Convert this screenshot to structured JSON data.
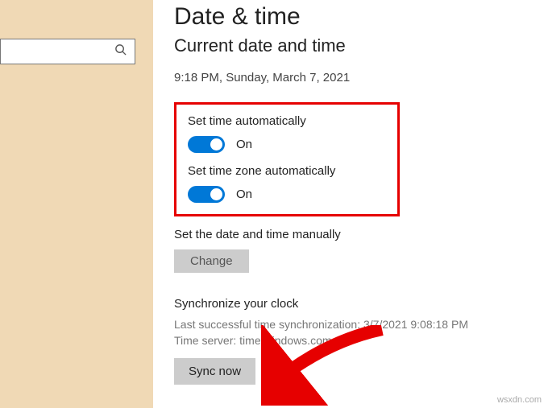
{
  "page": {
    "title": "Date & time",
    "section": "Current date and time",
    "current_datetime": "9:18 PM, Sunday, March 7, 2021"
  },
  "settings": {
    "set_time_auto": {
      "label": "Set time automatically",
      "state": "On"
    },
    "set_tz_auto": {
      "label": "Set time zone automatically",
      "state": "On"
    },
    "manual": {
      "label": "Set the date and time manually",
      "button": "Change"
    }
  },
  "sync": {
    "title": "Synchronize your clock",
    "last_line": "Last successful time synchronization: 3/7/2021 9:08:18 PM",
    "server_line": "Time server: time.windows.com",
    "button": "Sync now"
  },
  "watermark": "wsxdn.com"
}
